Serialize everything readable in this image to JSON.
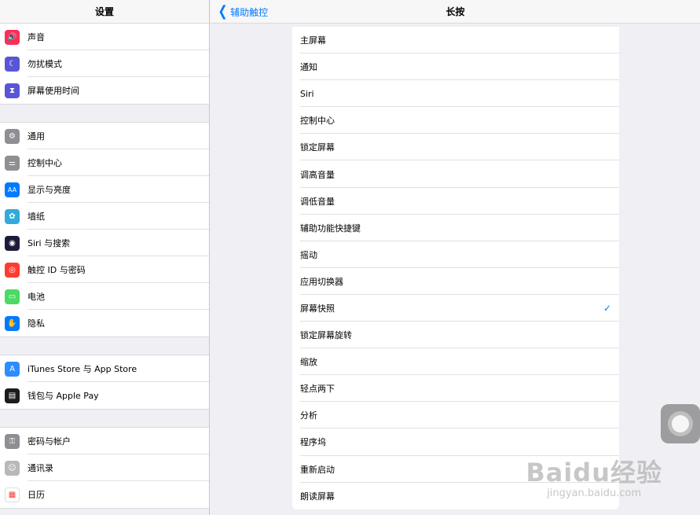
{
  "sidebar": {
    "title": "设置",
    "groups": [
      [
        {
          "label": "声音",
          "icon": "speaker-icon",
          "color": "#ff2d55"
        },
        {
          "label": "勿扰模式",
          "icon": "moon-icon",
          "color": "#5856d6"
        },
        {
          "label": "屏幕使用时间",
          "icon": "hourglass-icon",
          "color": "#5856d6"
        }
      ],
      [
        {
          "label": "通用",
          "icon": "gear-icon",
          "color": "#8e8e93"
        },
        {
          "label": "控制中心",
          "icon": "toggles-icon",
          "color": "#8e8e93"
        },
        {
          "label": "显示与亮度",
          "icon": "text-size-icon",
          "color": "#007aff"
        },
        {
          "label": "墙纸",
          "icon": "flower-icon",
          "color": "#34aadc"
        },
        {
          "label": "Siri 与搜索",
          "icon": "siri-icon",
          "color": "#1c1c3a"
        },
        {
          "label": "触控 ID 与密码",
          "icon": "fingerprint-icon",
          "color": "#ff3b30"
        },
        {
          "label": "电池",
          "icon": "battery-icon",
          "color": "#4cd964"
        },
        {
          "label": "隐私",
          "icon": "hand-icon",
          "color": "#007aff"
        }
      ],
      [
        {
          "label": "iTunes Store 与 App Store",
          "icon": "app-store-icon",
          "color": "#2d8cff"
        },
        {
          "label": "钱包与 Apple Pay",
          "icon": "wallet-icon",
          "color": "#1c1c1e"
        }
      ],
      [
        {
          "label": "密码与帐户",
          "icon": "key-icon",
          "color": "#8e8e93"
        },
        {
          "label": "通讯录",
          "icon": "contacts-icon",
          "color": "#b8b8b8"
        },
        {
          "label": "日历",
          "icon": "calendar-icon",
          "color": "#ffffff"
        }
      ]
    ]
  },
  "nav": {
    "back_label": "辅助触控",
    "title": "长按"
  },
  "list": {
    "items": [
      {
        "label": "主屏幕",
        "checked": false
      },
      {
        "label": "通知",
        "checked": false
      },
      {
        "label": "Siri",
        "checked": false
      },
      {
        "label": "控制中心",
        "checked": false
      },
      {
        "label": "锁定屏幕",
        "checked": false
      },
      {
        "label": "调高音量",
        "checked": false
      },
      {
        "label": "调低音量",
        "checked": false
      },
      {
        "label": "辅助功能快捷键",
        "checked": false
      },
      {
        "label": "摇动",
        "checked": false
      },
      {
        "label": "应用切换器",
        "checked": false
      },
      {
        "label": "屏幕快照",
        "checked": true
      },
      {
        "label": "锁定屏幕旋转",
        "checked": false
      },
      {
        "label": "缩放",
        "checked": false
      },
      {
        "label": "轻点两下",
        "checked": false
      },
      {
        "label": "分析",
        "checked": false
      },
      {
        "label": "程序坞",
        "checked": false
      },
      {
        "label": "重新启动",
        "checked": false
      },
      {
        "label": "朗读屏幕",
        "checked": false
      }
    ],
    "check_glyph": "✓"
  },
  "watermark": {
    "logo": "Baidu经验",
    "url": "jingyan.baidu.com"
  },
  "colors": {
    "accent": "#007aff",
    "background": "#efeff4"
  }
}
